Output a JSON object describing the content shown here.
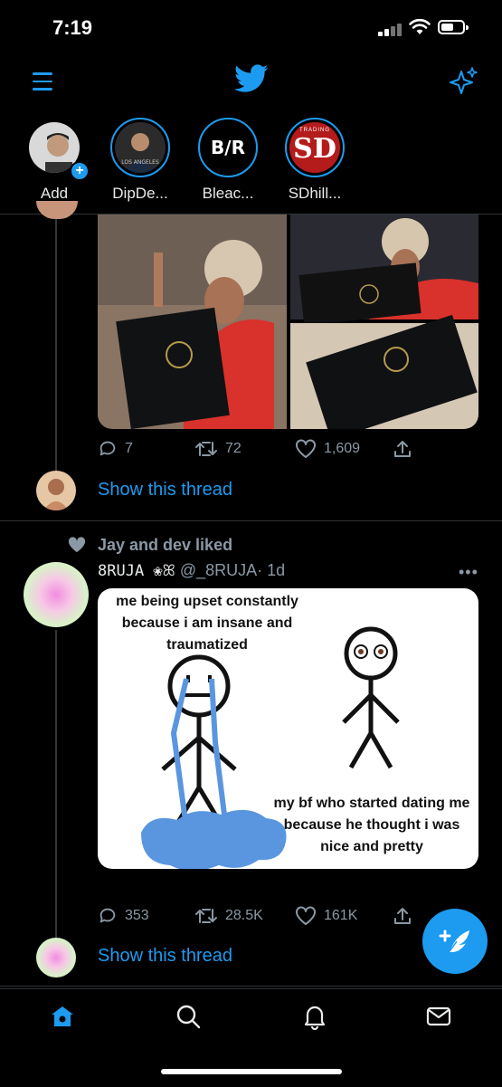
{
  "status": {
    "time": "7:19"
  },
  "fleets": [
    {
      "label": "Add"
    },
    {
      "label": "DipDe..."
    },
    {
      "label": "Bleac..."
    },
    {
      "label": "SDhill..."
    }
  ],
  "fleet_logos": {
    "bleacher": "B/R",
    "sd_small": "TRADING",
    "sd_big": "SD"
  },
  "tweet1": {
    "replies": "7",
    "retweets": "72",
    "likes": "1,609",
    "show_thread": "Show this thread"
  },
  "tweet2": {
    "liked_by": "Jay and dev liked",
    "display_name": "8RUJA ❀ꕤ",
    "handle": "@_8RUJA",
    "time": "· 1d",
    "meme_left": "me being upset constantly because i am insane and traumatized",
    "meme_right": "my bf who started dating me because he thought i was nice and pretty",
    "replies": "353",
    "retweets": "28.5K",
    "likes": "161K",
    "show_thread": "Show this thread"
  },
  "colors": {
    "accent": "#1d9bf0",
    "bg": "#000000",
    "muted": "#8b98a5"
  },
  "icons": [
    "menu-icon",
    "twitter-bird-icon",
    "sparkle-icon",
    "reply-icon",
    "retweet-icon",
    "heart-icon",
    "share-icon",
    "compose-icon",
    "home-icon",
    "search-icon",
    "bell-icon",
    "mail-icon"
  ]
}
